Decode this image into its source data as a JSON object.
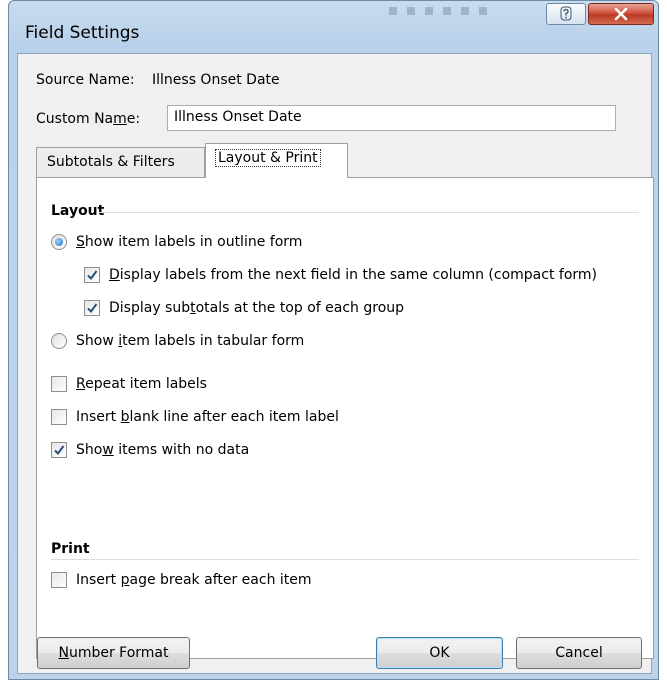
{
  "window": {
    "title": "Field Settings",
    "help_label": "?",
    "close_label": "X"
  },
  "source": {
    "label": "Source Name:",
    "value": "Illness Onset Date"
  },
  "custom_name": {
    "label_pre": "Custom Na",
    "label_accel": "m",
    "label_post": "e:",
    "value": "Illness Onset Date"
  },
  "tabs": [
    {
      "label": "Subtotals & Filters",
      "active": false
    },
    {
      "label": "Layout & Print",
      "active": true
    }
  ],
  "layout": {
    "title": "Layout",
    "outline_form": {
      "accel": "S",
      "rest": "how item labels in outline form",
      "checked": true
    },
    "compact_form": {
      "accel": "D",
      "rest": "isplay labels from the next field in the same column (compact form)",
      "checked": true
    },
    "subtotals_top": {
      "pre": "Display sub",
      "accel": "t",
      "post": "otals at the top of each group",
      "checked": true
    },
    "tabular_form": {
      "pre": "Show ",
      "accel": "i",
      "post": "tem labels in tabular form",
      "checked": false
    },
    "repeat_labels": {
      "accel": "R",
      "rest": "epeat item labels",
      "checked": false
    },
    "blank_line": {
      "pre": "Insert ",
      "accel": "b",
      "post": "lank line after each item label",
      "checked": false
    },
    "no_data": {
      "pre": "Sho",
      "accel": "w",
      "post": " items with no data",
      "checked": true
    }
  },
  "print": {
    "title": "Print",
    "page_break": {
      "pre": "Insert ",
      "accel": "p",
      "post": "age break after each item",
      "checked": false
    }
  },
  "buttons": {
    "number_format": {
      "accel": "N",
      "rest": "umber Format"
    },
    "ok": "OK",
    "cancel": "Cancel"
  },
  "colors": {
    "titlebar": "#b9d1ea",
    "close": "#c9452e",
    "client": "#f0f0f0",
    "check": "#2b4f7d"
  }
}
